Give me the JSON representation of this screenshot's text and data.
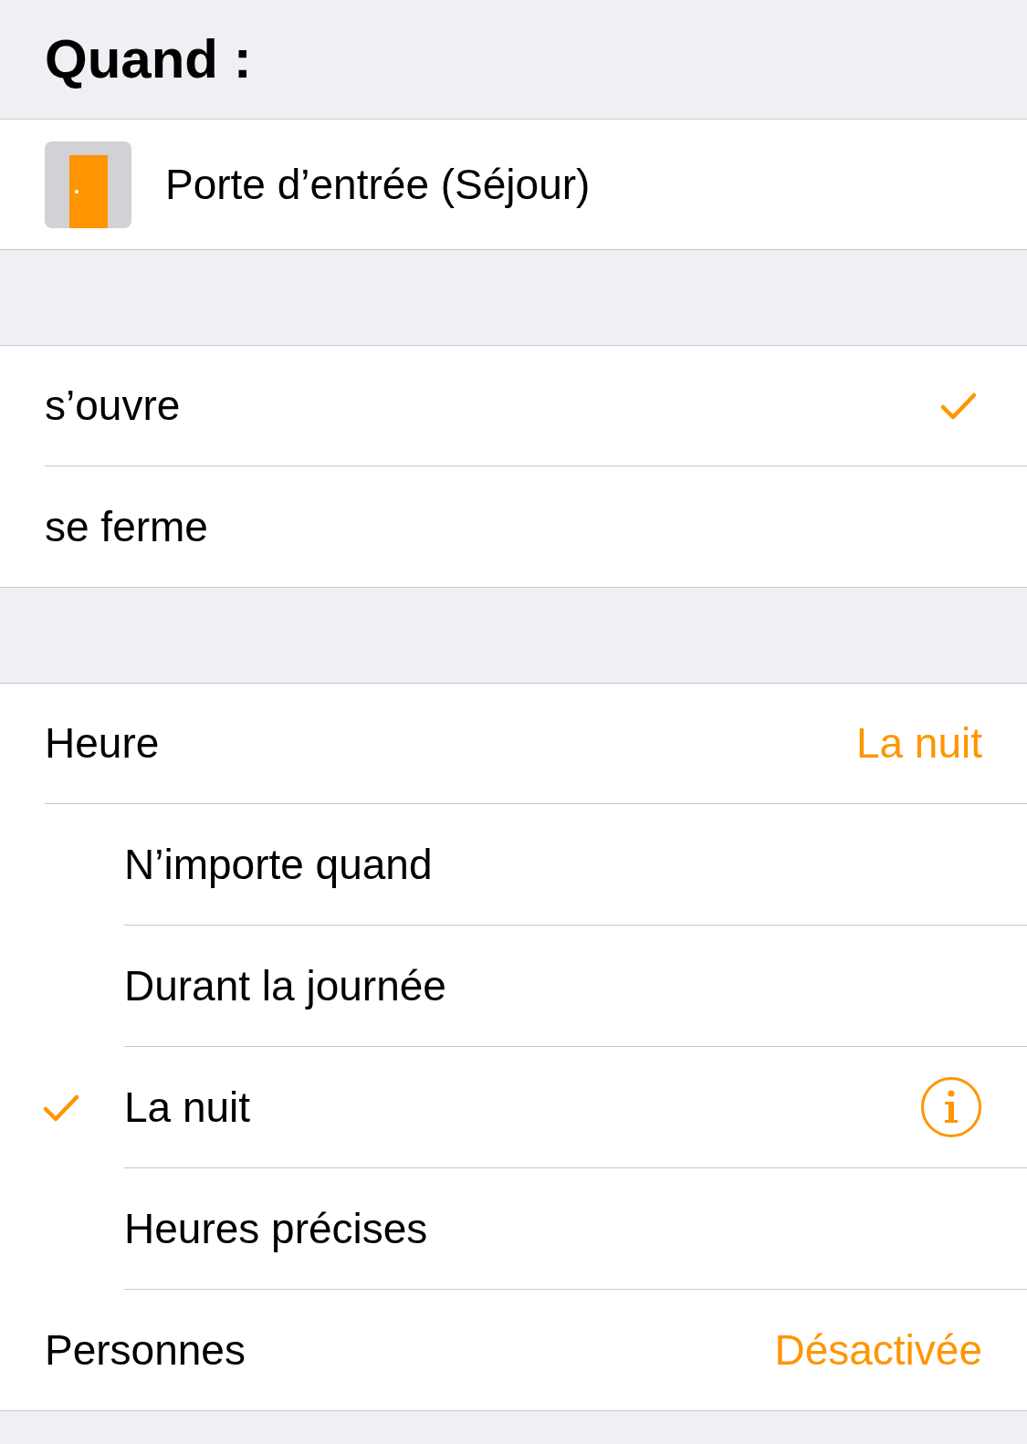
{
  "header": {
    "title": "Quand :"
  },
  "accessory": {
    "name": "Porte d’entrée (Séjour)"
  },
  "events": [
    {
      "label": "s’ouvre",
      "selected": true
    },
    {
      "label": "se ferme",
      "selected": false
    }
  ],
  "time": {
    "label": "Heure",
    "value": "La nuit",
    "options": [
      {
        "label": "N’importe quand",
        "selected": false
      },
      {
        "label": "Durant la journée",
        "selected": false
      },
      {
        "label": "La nuit",
        "selected": true
      },
      {
        "label": "Heures précises",
        "selected": false
      }
    ]
  },
  "people": {
    "label": "Personnes",
    "value": "Désactivée"
  }
}
